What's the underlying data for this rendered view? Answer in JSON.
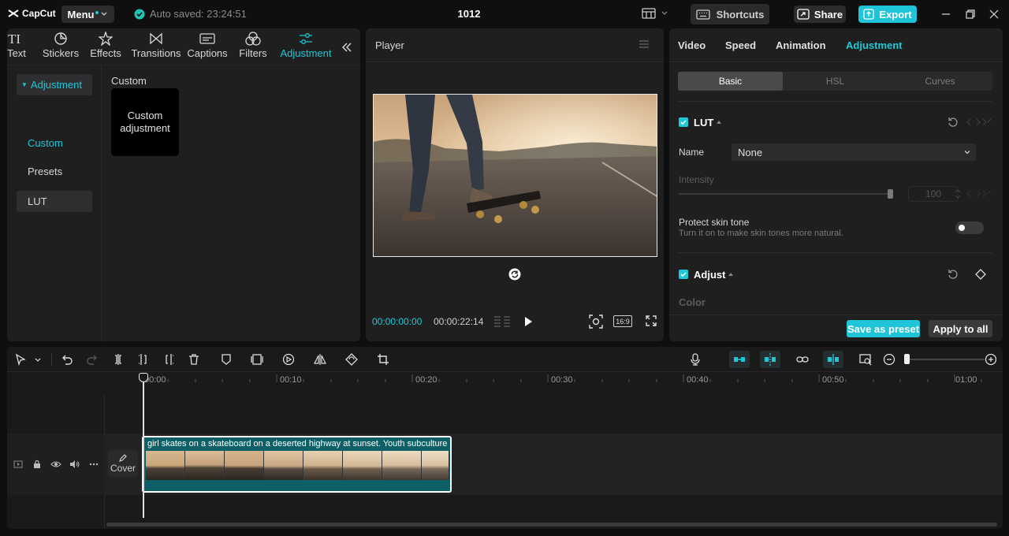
{
  "app": {
    "logo_text": "CapCut",
    "menu_label": "Menu",
    "autosave_text": "Auto saved: 23:24:51",
    "project_title": "1012",
    "shortcuts_label": "Shortcuts",
    "share_label": "Share",
    "export_label": "Export"
  },
  "media_tabs": [
    {
      "label": "Text",
      "icon": "text-icon"
    },
    {
      "label": "Stickers",
      "icon": "sticker-icon"
    },
    {
      "label": "Effects",
      "icon": "effects-icon"
    },
    {
      "label": "Transitions",
      "icon": "transitions-icon"
    },
    {
      "label": "Captions",
      "icon": "captions-icon"
    },
    {
      "label": "Filters",
      "icon": "filters-icon"
    },
    {
      "label": "Adjustment",
      "icon": "adjustment-icon",
      "active": true
    }
  ],
  "sidenav": {
    "items": [
      {
        "label": "Adjustment",
        "active": true
      },
      {
        "label": "Custom"
      },
      {
        "label": "Presets"
      },
      {
        "label": "LUT"
      }
    ]
  },
  "custom": {
    "header": "Custom",
    "card_label": "Custom adjustment"
  },
  "player": {
    "title": "Player",
    "current_time": "00:00:00:00",
    "total_time": "00:00:22:14",
    "aspect_ratio": "16:9"
  },
  "props": {
    "tabs": [
      {
        "label": "Video"
      },
      {
        "label": "Speed"
      },
      {
        "label": "Animation"
      },
      {
        "label": "Adjustment",
        "active": true
      }
    ],
    "subtabs": [
      {
        "label": "Basic",
        "active": true
      },
      {
        "label": "HSL"
      },
      {
        "label": "Curves"
      }
    ],
    "lut": {
      "title": "LUT",
      "name_label": "Name",
      "name_value": "None",
      "intensity_label": "Intensity",
      "intensity_value": "100",
      "intensity_level": 1.0
    },
    "protect_skin": {
      "title": "Protect skin tone",
      "desc": "Turn it on to make skin tones more natural.",
      "enabled": false
    },
    "adjust": {
      "title": "Adjust",
      "color_label": "Color"
    },
    "save_preset_label": "Save as preset",
    "apply_all_label": "Apply to all"
  },
  "timeline": {
    "ruler_labels": [
      "00:00",
      "00:10",
      "00:20",
      "00:30",
      "00:40",
      "00:50",
      "01:00"
    ],
    "clip_title": "girl skates on a skateboard on a deserted highway at sunset. Youth subculture",
    "cover_label": "Cover"
  },
  "colors": {
    "accent": "#1fc8d6",
    "panel": "#1f1f20",
    "background": "#0f0f10"
  }
}
